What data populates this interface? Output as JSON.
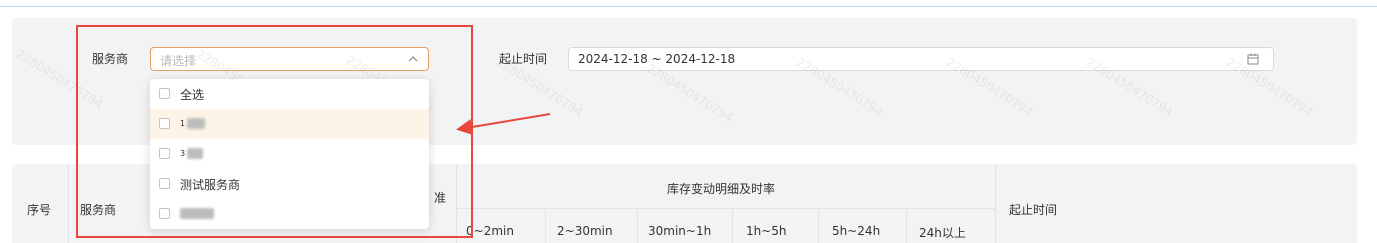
{
  "filters": {
    "provider_label": "服务商",
    "provider_placeholder": "请选择",
    "date_label": "起止时间",
    "date_value": "2024-12-18 ~ 2024-12-18"
  },
  "dropdown": {
    "options": [
      {
        "label": "全选",
        "redacted": false,
        "highlighted": false
      },
      {
        "label": "1",
        "redacted": true,
        "highlighted": true
      },
      {
        "label": "3",
        "redacted": true,
        "highlighted": false
      },
      {
        "label": "测试服务商",
        "redacted": false,
        "highlighted": false
      },
      {
        "label": "",
        "redacted": true,
        "highlighted": false
      }
    ]
  },
  "table": {
    "col_index": "序号",
    "col_provider": "服务商",
    "col_partial": "准",
    "group_header": "库存变动明细及时率",
    "sub_headers": [
      "0~2min",
      "2~30min",
      "30min~1h",
      "1h~5h",
      "5h~24h",
      "24h以上"
    ],
    "col_time": "起止时间"
  },
  "watermark": "2280450470794",
  "colors": {
    "accent": "#e8a060",
    "annotation": "#e8473b",
    "highlight_row": "#fdf3e6"
  }
}
